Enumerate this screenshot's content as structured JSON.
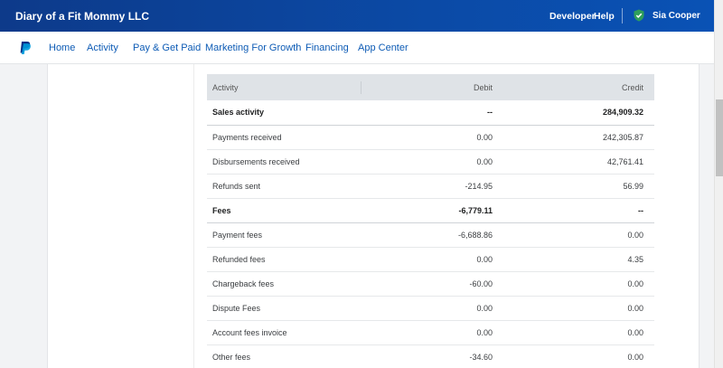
{
  "header": {
    "brand": "Diary of a Fit Mommy LLC",
    "developer": "Developer",
    "help": "Help",
    "user": "Sia Cooper"
  },
  "nav": {
    "items": [
      "Home",
      "Activity",
      "Pay & Get Paid",
      "Marketing For Growth",
      "Financing",
      "App Center"
    ]
  },
  "table": {
    "columns": [
      "Activity",
      "Debit",
      "Credit"
    ],
    "rows": [
      {
        "label": "Sales activity",
        "debit": "--",
        "credit": "284,909.32",
        "bold": true
      },
      {
        "label": "Payments received",
        "debit": "0.00",
        "credit": "242,305.87"
      },
      {
        "label": "Disbursements received",
        "debit": "0.00",
        "credit": "42,761.41"
      },
      {
        "label": "Refunds sent",
        "debit": "-214.95",
        "credit": "56.99"
      },
      {
        "label": "Fees",
        "debit": "-6,779.11",
        "credit": "--",
        "bold": true
      },
      {
        "label": "Payment fees",
        "debit": "-6,688.86",
        "credit": "0.00"
      },
      {
        "label": "Refunded fees",
        "debit": "0.00",
        "credit": "4.35"
      },
      {
        "label": "Chargeback fees",
        "debit": "-60.00",
        "credit": "0.00"
      },
      {
        "label": "Dispute Fees",
        "debit": "0.00",
        "credit": "0.00"
      },
      {
        "label": "Account fees invoice",
        "debit": "0.00",
        "credit": "0.00"
      },
      {
        "label": "Other fees",
        "debit": "-34.60",
        "credit": "0.00"
      }
    ]
  },
  "colors": {
    "topbar": "#0b4aa6",
    "nav_link": "#0d5bb5",
    "table_header_bg": "#dfe3e7",
    "shield": "#2e9e5b"
  }
}
